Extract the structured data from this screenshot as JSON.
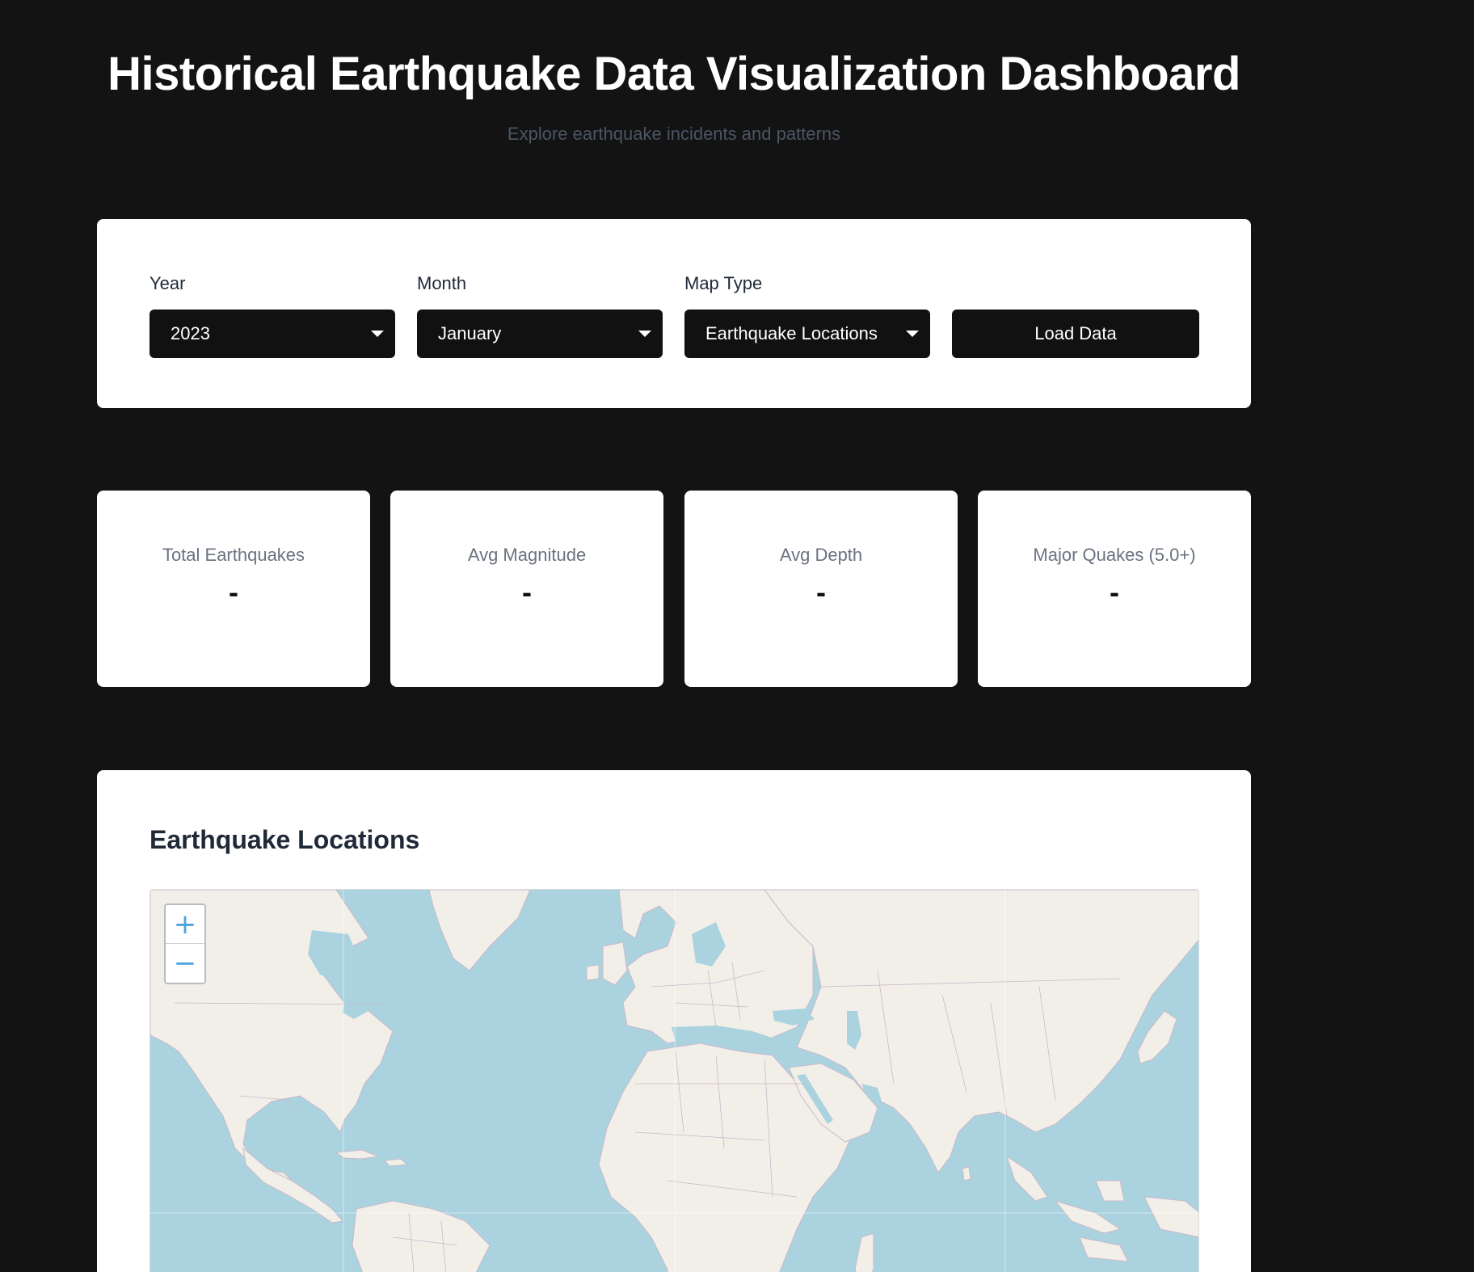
{
  "header": {
    "title": "Historical Earthquake Data Visualization Dashboard",
    "subtitle": "Explore earthquake incidents and patterns"
  },
  "controls": {
    "year": {
      "label": "Year",
      "value": "2023"
    },
    "month": {
      "label": "Month",
      "value": "January"
    },
    "map_type": {
      "label": "Map Type",
      "value": "Earthquake Locations"
    },
    "load_button": "Load Data"
  },
  "stats": [
    {
      "label": "Total Earthquakes",
      "value": "-"
    },
    {
      "label": "Avg Magnitude",
      "value": "-"
    },
    {
      "label": "Avg Depth",
      "value": "-"
    },
    {
      "label": "Major Quakes (5.0+)",
      "value": "-"
    }
  ],
  "map": {
    "title": "Earthquake Locations",
    "zoom_in": "+",
    "zoom_out": "−"
  },
  "colors": {
    "page_background": "#131314",
    "card_background": "#ffffff",
    "control_background": "#111111",
    "ocean": "#aad3df",
    "land": "#f2efe9",
    "zoom_accent": "#4aa3df"
  },
  "icons": {
    "dropdown": "caret-down-icon"
  }
}
